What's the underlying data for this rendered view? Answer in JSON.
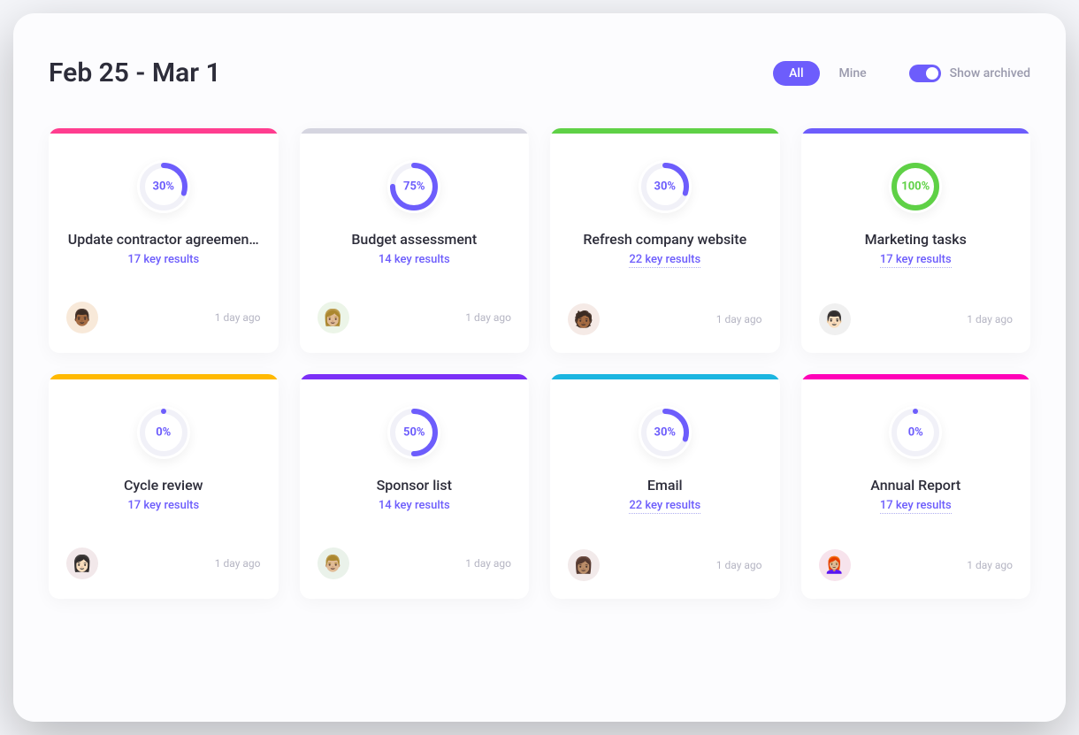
{
  "header": {
    "date_range": "Feb 25 - Mar 1",
    "filter_all": "All",
    "filter_mine": "Mine",
    "toggle_label": "Show archived"
  },
  "cards": [
    {
      "top_color": "#ff3d8f",
      "progress": 30,
      "progress_label": "30%",
      "ring_color": "#6d5dfc",
      "pct_color": "#6d5dfc",
      "title": "Update contractor agreemen…",
      "key_results": "17 key results",
      "kr_underlined": false,
      "avatar_bg": "#f8e9d9",
      "avatar_emoji": "👨🏾",
      "timestamp": "1 day ago"
    },
    {
      "top_color": "#d5d5e0",
      "progress": 75,
      "progress_label": "75%",
      "ring_color": "#6d5dfc",
      "pct_color": "#6d5dfc",
      "title": "Budget assessment",
      "key_results": "14 key results",
      "kr_underlined": false,
      "avatar_bg": "#ecf5e8",
      "avatar_emoji": "👩🏼",
      "timestamp": "1 day ago"
    },
    {
      "top_color": "#5fd146",
      "progress": 30,
      "progress_label": "30%",
      "ring_color": "#6d5dfc",
      "pct_color": "#6d5dfc",
      "title": "Refresh company website",
      "key_results": "22 key results",
      "kr_underlined": true,
      "avatar_bg": "#f5eae6",
      "avatar_emoji": "🧑🏾",
      "timestamp": "1 day ago"
    },
    {
      "top_color": "#6d5dfc",
      "progress": 100,
      "progress_label": "100%",
      "ring_color": "#5fd146",
      "pct_color": "#5fd146",
      "title": "Marketing tasks",
      "key_results": "17 key results",
      "kr_underlined": true,
      "avatar_bg": "#f0f0f0",
      "avatar_emoji": "👨🏻",
      "timestamp": "1 day ago"
    },
    {
      "top_color": "#ffb900",
      "progress": 0,
      "progress_label": "0%",
      "ring_color": "#6d5dfc",
      "pct_color": "#6d5dfc",
      "title": "Cycle review",
      "key_results": "17 key results",
      "kr_underlined": false,
      "avatar_bg": "#f2e8ea",
      "avatar_emoji": "👩🏻",
      "timestamp": "1 day ago"
    },
    {
      "top_color": "#7b2ff7",
      "progress": 50,
      "progress_label": "50%",
      "ring_color": "#6d5dfc",
      "pct_color": "#6d5dfc",
      "title": "Sponsor list",
      "key_results": "14 key results",
      "kr_underlined": false,
      "avatar_bg": "#eaf2ea",
      "avatar_emoji": "👨🏼",
      "timestamp": "1 day ago"
    },
    {
      "top_color": "#1bb5e0",
      "progress": 30,
      "progress_label": "30%",
      "ring_color": "#6d5dfc",
      "pct_color": "#6d5dfc",
      "title": "Email",
      "key_results": "22 key results",
      "kr_underlined": true,
      "avatar_bg": "#f2eaea",
      "avatar_emoji": "👩🏽",
      "timestamp": "1 day ago"
    },
    {
      "top_color": "#ff00b8",
      "progress": 0,
      "progress_label": "0%",
      "ring_color": "#6d5dfc",
      "pct_color": "#6d5dfc",
      "title": "Annual Report",
      "key_results": "17 key results",
      "kr_underlined": true,
      "avatar_bg": "#f7e3ec",
      "avatar_emoji": "👩🏼‍🦰",
      "timestamp": "1 day ago"
    }
  ]
}
